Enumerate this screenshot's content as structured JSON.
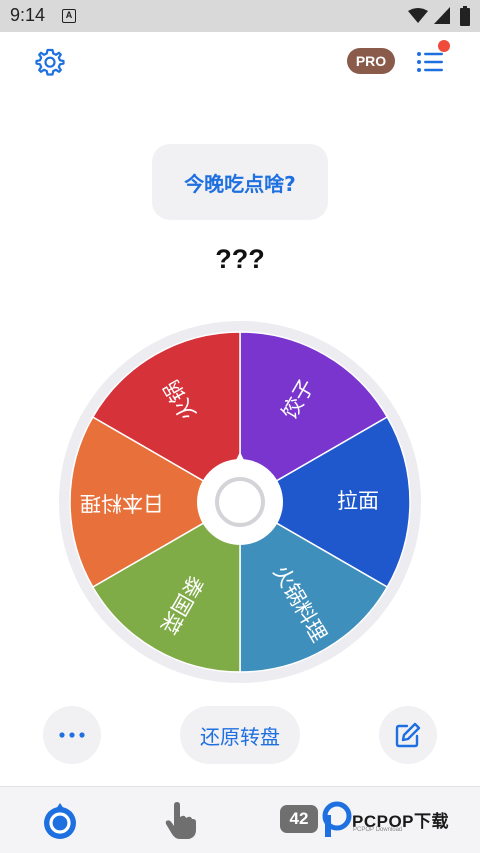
{
  "status_bar": {
    "time": "9:14",
    "notification_glyph": "A"
  },
  "top_bar": {
    "settings_icon": "gear-icon",
    "pro_label": "PRO",
    "menu_icon": "list-icon"
  },
  "question": "今晚吃点啥?",
  "result": "???",
  "wheel": {
    "segments": [
      {
        "label": "饺子",
        "color": "#7a35cf"
      },
      {
        "label": "拉面",
        "color": "#1f57cc"
      },
      {
        "label": "火锅料理",
        "color": "#3f8fbc"
      },
      {
        "label": "泰国菜",
        "color": "#80ac48"
      },
      {
        "label": "日本料理",
        "color": "#e8703a"
      },
      {
        "label": "火锅",
        "color": "#d6323a"
      }
    ],
    "rim_color": "#ececf1"
  },
  "actions": {
    "more_icon": "more-icon",
    "reset_label": "还原转盘",
    "edit_icon": "edit-icon"
  },
  "bottom_bar": {
    "count": "42",
    "watermark": "PCPOP下载",
    "watermark_sub": "PCPOP Download"
  },
  "colors": {
    "accent": "#1e6fe0",
    "pro": "#8a5a4b",
    "dot": "#ef4a3a"
  }
}
